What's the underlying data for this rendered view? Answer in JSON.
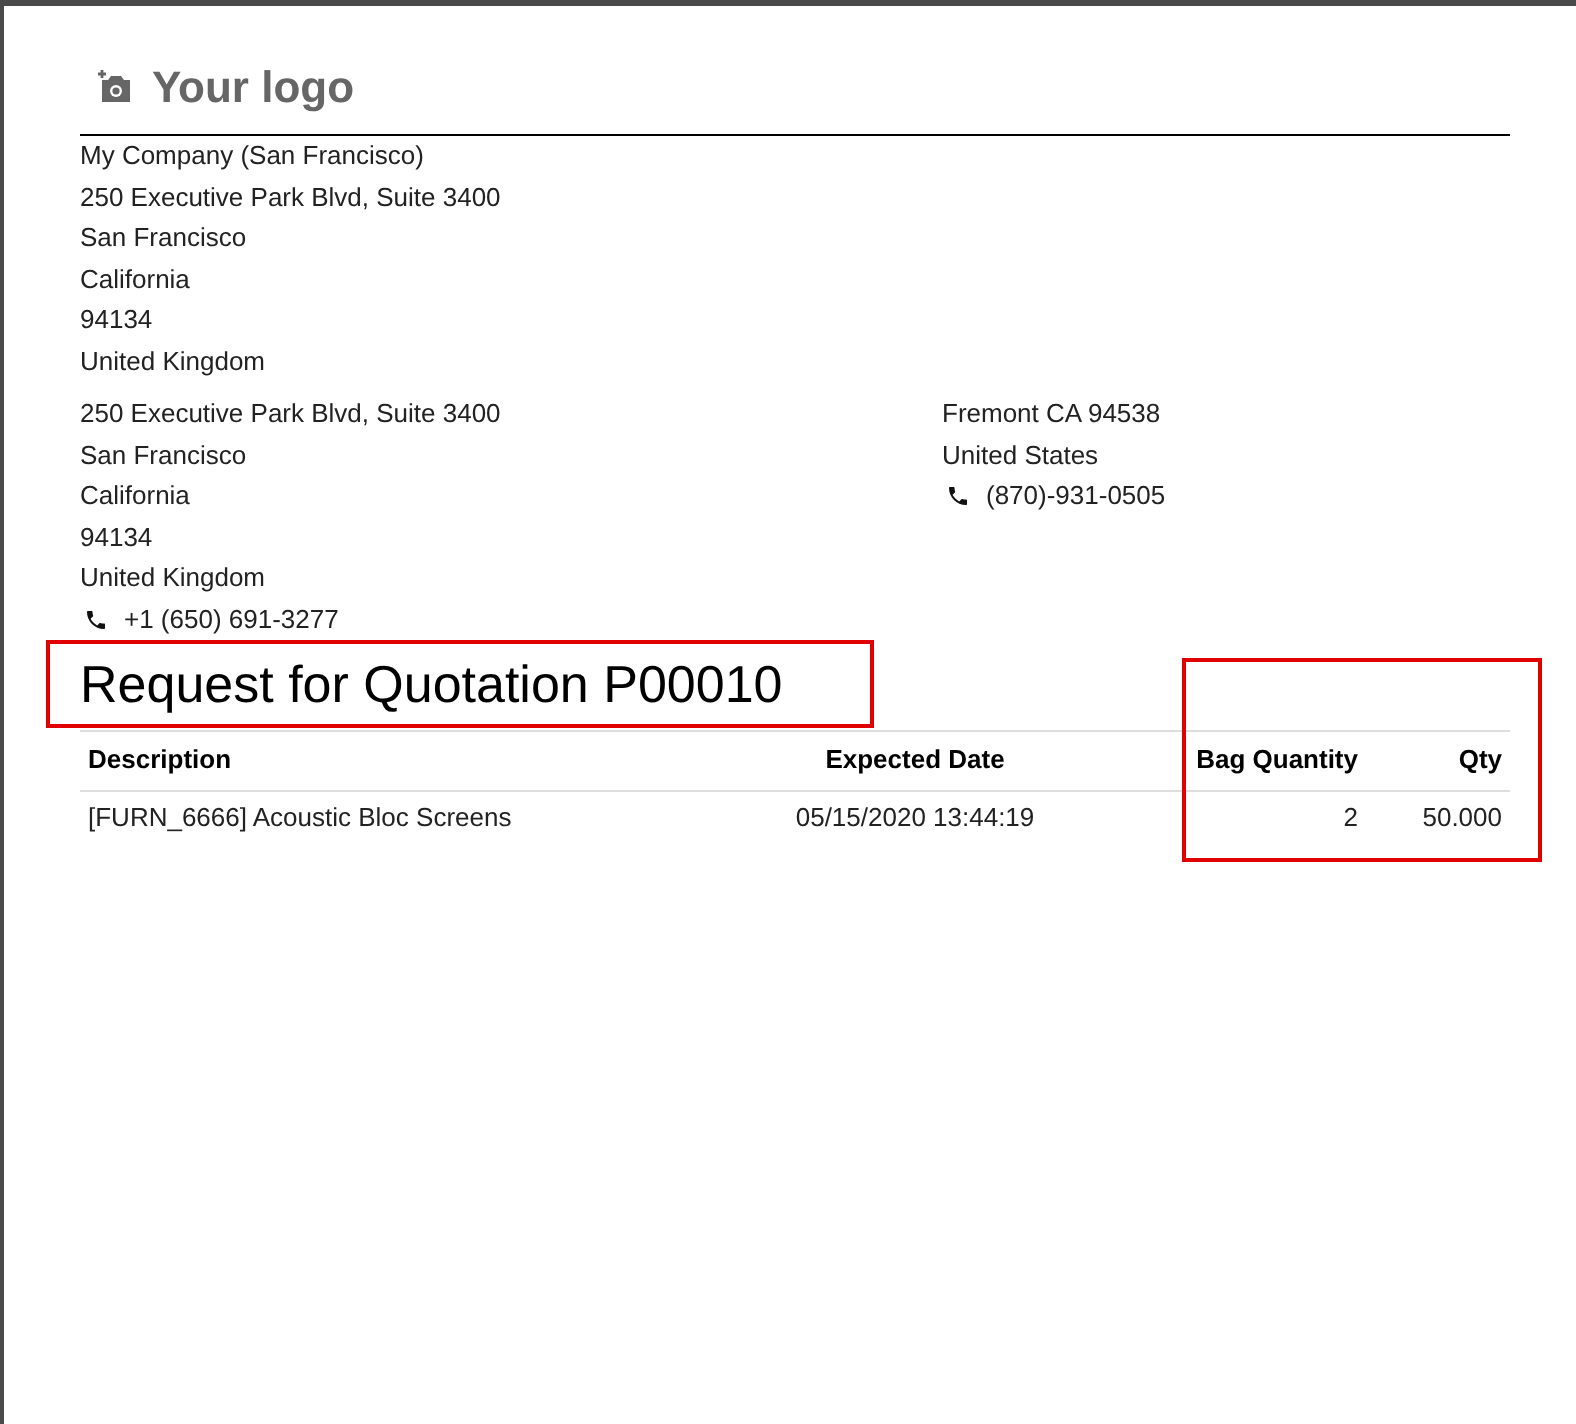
{
  "logo": {
    "text": "Your logo"
  },
  "company_address": [
    "My Company (San Francisco)",
    "250 Executive Park Blvd, Suite 3400",
    "San Francisco",
    "California",
    "94134",
    "United Kingdom"
  ],
  "ship_to": {
    "lines": [
      "250 Executive Park Blvd, Suite 3400",
      "San Francisco",
      "California",
      "94134",
      "United Kingdom"
    ],
    "phone": "+1 (650) 691-3277"
  },
  "vendor": {
    "lines": [
      "Fremont CA 94538",
      "United States"
    ],
    "phone": "(870)-931-0505"
  },
  "title": "Request for Quotation P00010",
  "table": {
    "columns": [
      "Description",
      "Expected Date",
      "Bag Quantity",
      "Qty"
    ],
    "rows": [
      [
        "[FURN_6666] Acoustic Bloc Screens",
        "05/15/2020 13:44:19",
        "2",
        "50.000"
      ]
    ]
  }
}
